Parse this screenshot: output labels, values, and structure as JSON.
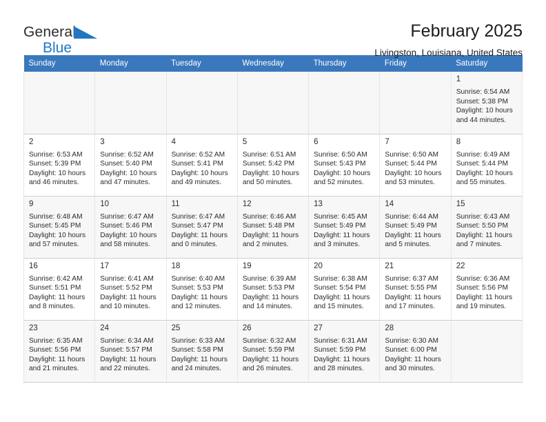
{
  "brand": {
    "name_part1": "General",
    "name_part2": "Blue",
    "flag_color": "#1f77c4"
  },
  "header": {
    "title": "February 2025",
    "location": "Livingston, Louisiana, United States"
  },
  "theme": {
    "header_row_bg": "#3a78bd",
    "header_row_text": "#ffffff",
    "alt_row_bg": "#f7f7f7",
    "cell_bg": "#ffffff",
    "text": "#2b2b2b"
  },
  "weekday_headers": [
    "Sunday",
    "Monday",
    "Tuesday",
    "Wednesday",
    "Thursday",
    "Friday",
    "Saturday"
  ],
  "weeks": [
    [
      {
        "empty": true
      },
      {
        "empty": true
      },
      {
        "empty": true
      },
      {
        "empty": true
      },
      {
        "empty": true
      },
      {
        "empty": true
      },
      {
        "day": "1",
        "sunrise": "Sunrise: 6:54 AM",
        "sunset": "Sunset: 5:38 PM",
        "daylight_line1": "Daylight: 10 hours",
        "daylight_line2": "and 44 minutes."
      }
    ],
    [
      {
        "day": "2",
        "sunrise": "Sunrise: 6:53 AM",
        "sunset": "Sunset: 5:39 PM",
        "daylight_line1": "Daylight: 10 hours",
        "daylight_line2": "and 46 minutes."
      },
      {
        "day": "3",
        "sunrise": "Sunrise: 6:52 AM",
        "sunset": "Sunset: 5:40 PM",
        "daylight_line1": "Daylight: 10 hours",
        "daylight_line2": "and 47 minutes."
      },
      {
        "day": "4",
        "sunrise": "Sunrise: 6:52 AM",
        "sunset": "Sunset: 5:41 PM",
        "daylight_line1": "Daylight: 10 hours",
        "daylight_line2": "and 49 minutes."
      },
      {
        "day": "5",
        "sunrise": "Sunrise: 6:51 AM",
        "sunset": "Sunset: 5:42 PM",
        "daylight_line1": "Daylight: 10 hours",
        "daylight_line2": "and 50 minutes."
      },
      {
        "day": "6",
        "sunrise": "Sunrise: 6:50 AM",
        "sunset": "Sunset: 5:43 PM",
        "daylight_line1": "Daylight: 10 hours",
        "daylight_line2": "and 52 minutes."
      },
      {
        "day": "7",
        "sunrise": "Sunrise: 6:50 AM",
        "sunset": "Sunset: 5:44 PM",
        "daylight_line1": "Daylight: 10 hours",
        "daylight_line2": "and 53 minutes."
      },
      {
        "day": "8",
        "sunrise": "Sunrise: 6:49 AM",
        "sunset": "Sunset: 5:44 PM",
        "daylight_line1": "Daylight: 10 hours",
        "daylight_line2": "and 55 minutes."
      }
    ],
    [
      {
        "day": "9",
        "sunrise": "Sunrise: 6:48 AM",
        "sunset": "Sunset: 5:45 PM",
        "daylight_line1": "Daylight: 10 hours",
        "daylight_line2": "and 57 minutes."
      },
      {
        "day": "10",
        "sunrise": "Sunrise: 6:47 AM",
        "sunset": "Sunset: 5:46 PM",
        "daylight_line1": "Daylight: 10 hours",
        "daylight_line2": "and 58 minutes."
      },
      {
        "day": "11",
        "sunrise": "Sunrise: 6:47 AM",
        "sunset": "Sunset: 5:47 PM",
        "daylight_line1": "Daylight: 11 hours",
        "daylight_line2": "and 0 minutes."
      },
      {
        "day": "12",
        "sunrise": "Sunrise: 6:46 AM",
        "sunset": "Sunset: 5:48 PM",
        "daylight_line1": "Daylight: 11 hours",
        "daylight_line2": "and 2 minutes."
      },
      {
        "day": "13",
        "sunrise": "Sunrise: 6:45 AM",
        "sunset": "Sunset: 5:49 PM",
        "daylight_line1": "Daylight: 11 hours",
        "daylight_line2": "and 3 minutes."
      },
      {
        "day": "14",
        "sunrise": "Sunrise: 6:44 AM",
        "sunset": "Sunset: 5:49 PM",
        "daylight_line1": "Daylight: 11 hours",
        "daylight_line2": "and 5 minutes."
      },
      {
        "day": "15",
        "sunrise": "Sunrise: 6:43 AM",
        "sunset": "Sunset: 5:50 PM",
        "daylight_line1": "Daylight: 11 hours",
        "daylight_line2": "and 7 minutes."
      }
    ],
    [
      {
        "day": "16",
        "sunrise": "Sunrise: 6:42 AM",
        "sunset": "Sunset: 5:51 PM",
        "daylight_line1": "Daylight: 11 hours",
        "daylight_line2": "and 8 minutes."
      },
      {
        "day": "17",
        "sunrise": "Sunrise: 6:41 AM",
        "sunset": "Sunset: 5:52 PM",
        "daylight_line1": "Daylight: 11 hours",
        "daylight_line2": "and 10 minutes."
      },
      {
        "day": "18",
        "sunrise": "Sunrise: 6:40 AM",
        "sunset": "Sunset: 5:53 PM",
        "daylight_line1": "Daylight: 11 hours",
        "daylight_line2": "and 12 minutes."
      },
      {
        "day": "19",
        "sunrise": "Sunrise: 6:39 AM",
        "sunset": "Sunset: 5:53 PM",
        "daylight_line1": "Daylight: 11 hours",
        "daylight_line2": "and 14 minutes."
      },
      {
        "day": "20",
        "sunrise": "Sunrise: 6:38 AM",
        "sunset": "Sunset: 5:54 PM",
        "daylight_line1": "Daylight: 11 hours",
        "daylight_line2": "and 15 minutes."
      },
      {
        "day": "21",
        "sunrise": "Sunrise: 6:37 AM",
        "sunset": "Sunset: 5:55 PM",
        "daylight_line1": "Daylight: 11 hours",
        "daylight_line2": "and 17 minutes."
      },
      {
        "day": "22",
        "sunrise": "Sunrise: 6:36 AM",
        "sunset": "Sunset: 5:56 PM",
        "daylight_line1": "Daylight: 11 hours",
        "daylight_line2": "and 19 minutes."
      }
    ],
    [
      {
        "day": "23",
        "sunrise": "Sunrise: 6:35 AM",
        "sunset": "Sunset: 5:56 PM",
        "daylight_line1": "Daylight: 11 hours",
        "daylight_line2": "and 21 minutes."
      },
      {
        "day": "24",
        "sunrise": "Sunrise: 6:34 AM",
        "sunset": "Sunset: 5:57 PM",
        "daylight_line1": "Daylight: 11 hours",
        "daylight_line2": "and 22 minutes."
      },
      {
        "day": "25",
        "sunrise": "Sunrise: 6:33 AM",
        "sunset": "Sunset: 5:58 PM",
        "daylight_line1": "Daylight: 11 hours",
        "daylight_line2": "and 24 minutes."
      },
      {
        "day": "26",
        "sunrise": "Sunrise: 6:32 AM",
        "sunset": "Sunset: 5:59 PM",
        "daylight_line1": "Daylight: 11 hours",
        "daylight_line2": "and 26 minutes."
      },
      {
        "day": "27",
        "sunrise": "Sunrise: 6:31 AM",
        "sunset": "Sunset: 5:59 PM",
        "daylight_line1": "Daylight: 11 hours",
        "daylight_line2": "and 28 minutes."
      },
      {
        "day": "28",
        "sunrise": "Sunrise: 6:30 AM",
        "sunset": "Sunset: 6:00 PM",
        "daylight_line1": "Daylight: 11 hours",
        "daylight_line2": "and 30 minutes."
      },
      {
        "empty": true
      }
    ]
  ]
}
